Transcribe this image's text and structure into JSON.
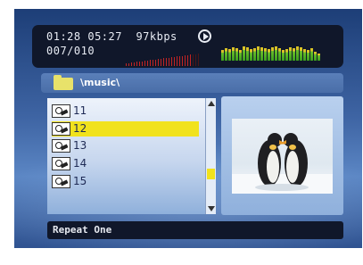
{
  "status": {
    "time": "01:28 05:27",
    "bitrate": "97kbps",
    "track": "007/010",
    "state_icon": "play-icon",
    "volume_level": 0.9
  },
  "path": {
    "folder_icon": "folder-icon",
    "text": "\\music\\"
  },
  "files": [
    {
      "name": "11",
      "icon": "audio-file-icon",
      "selected": false
    },
    {
      "name": "12",
      "icon": "audio-file-icon",
      "selected": true
    },
    {
      "name": "13",
      "icon": "audio-file-icon",
      "selected": false
    },
    {
      "name": "14",
      "icon": "audio-file-icon",
      "selected": false
    },
    {
      "name": "15",
      "icon": "audio-file-icon",
      "selected": false
    }
  ],
  "preview": {
    "icon": "penguins-image"
  },
  "footer": {
    "mode": "Repeat One"
  },
  "colors": {
    "highlight": "#f1e21d",
    "bar_bg": "#10172a",
    "volume": "#c22424"
  }
}
